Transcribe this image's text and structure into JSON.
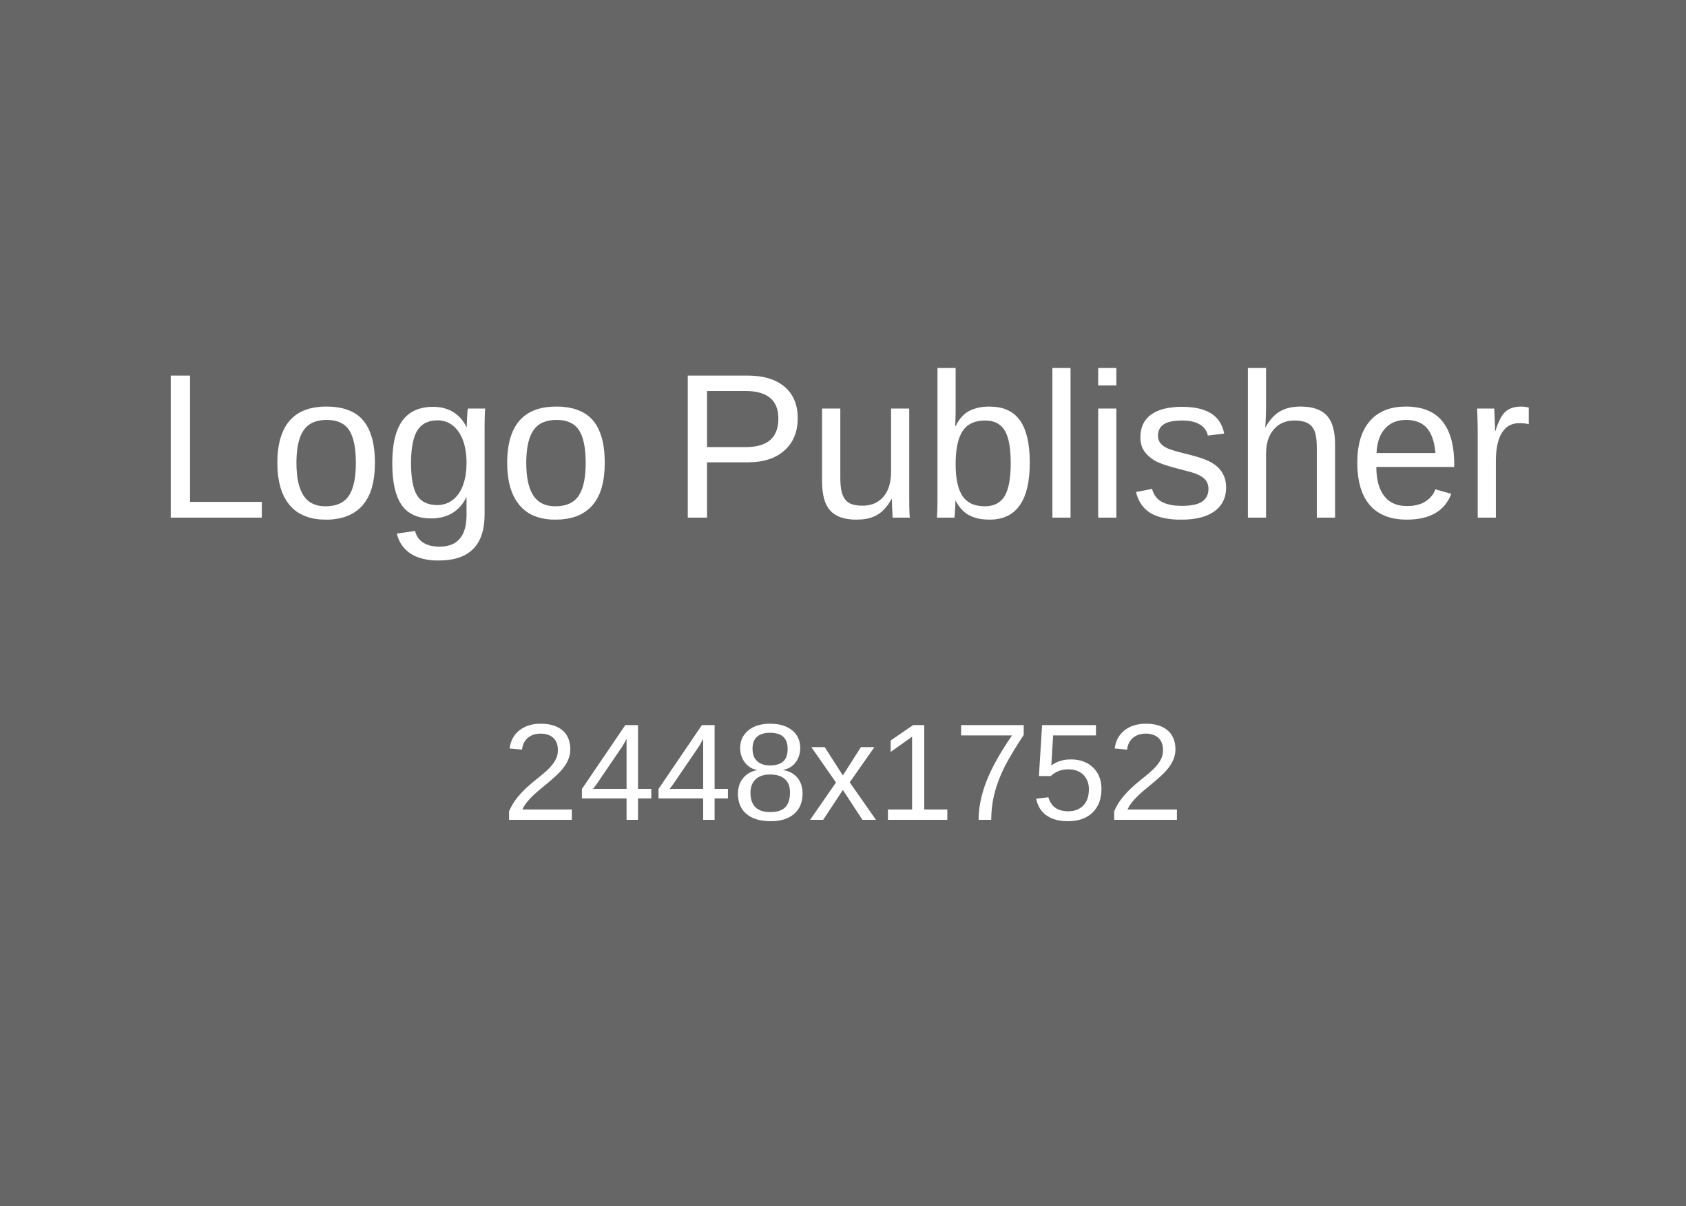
{
  "placeholder": {
    "title": "Logo Publisher",
    "dimensions": "2448x1752",
    "background_color": "#666666",
    "text_color": "#ffffff"
  }
}
